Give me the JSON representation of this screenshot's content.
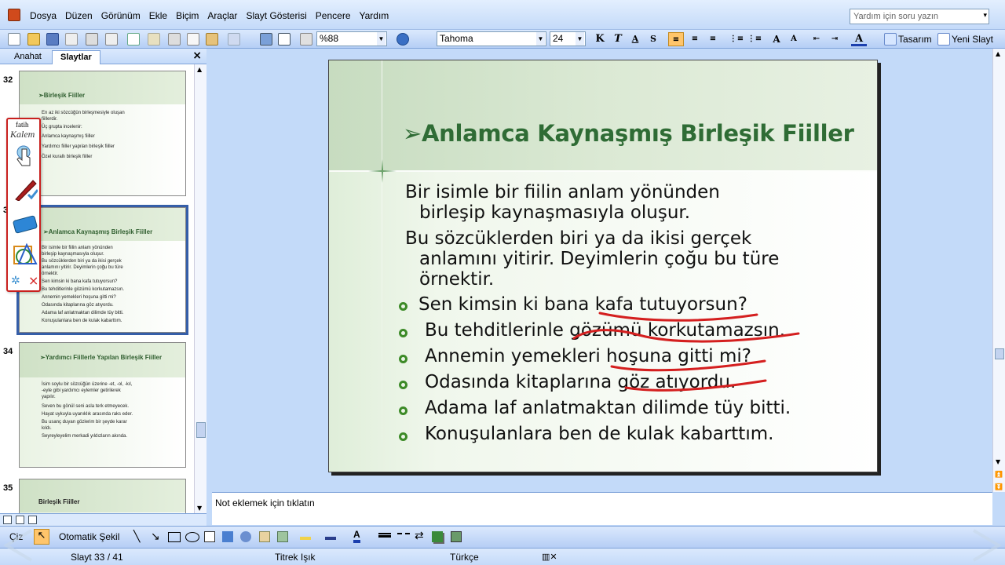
{
  "menu": {
    "items": [
      "Dosya",
      "Düzen",
      "Görünüm",
      "Ekle",
      "Biçim",
      "Araçlar",
      "Slayt Gösterisi",
      "Pencere",
      "Yardım"
    ],
    "help_placeholder": "Yardım için soru yazın"
  },
  "toolbar": {
    "zoom": "%88",
    "font_name": "Tahoma",
    "font_size": "24",
    "bold": "K",
    "italic": "T",
    "underline": "A",
    "shadow": "S",
    "design_label": "Tasarım",
    "new_slide_label": "Yeni Slayt"
  },
  "left_pane": {
    "tabs": [
      "Anahat",
      "Slaytlar"
    ],
    "close": "×",
    "slides": [
      {
        "number": "32",
        "title": "➢Birleşik Fiiller",
        "lines": [
          "En az iki sözcüğün birleşmesiyle oluşan",
          "fiillerdir.",
          "Üç grupta incelenir:",
          "Anlamca kaynaşmış fiiller",
          "Yardımcı fiiller yapılan birleşik fiiller",
          "Özel kurallı birleşik fiiller"
        ]
      },
      {
        "number": "33",
        "title": "➢Anlamca Kaynaşmış Birleşik Fiiller",
        "lines": [
          "Bir isimle bir fiilin anlam yönünden",
          "birleşip kaynaşmasıyla oluşur.",
          "Bu sözcüklerden biri ya da ikisi gerçek",
          "anlamını yitirir. Deyimlerin çoğu bu türe",
          "örnektir.",
          "Sen kimsin ki bana kafa tutuyorsun?",
          "Bu tehditlerinle gözümü korkutamazsın.",
          "Annemin yemekleri hoşuna gitti mi?",
          "Odasında kitaplarına göz atıyordu.",
          "Adama laf anlatmaktan dilimde tüy bitti.",
          "Konuşulanlara ben de kulak kabarttım."
        ]
      },
      {
        "number": "34",
        "title": "➢Yardımcı Fiillerle Yapılan Birleşik Fiiller",
        "lines": [
          "İsim soylu bir sözcüğün üzerine -et, -ol, -kıl,",
          "-eyle gibi yardımcı eylemler getirilerek",
          "yapılır.",
          "Seven bu gönül seni asla terk etmeyecek.",
          "Hayat uykuyla uyanıklık arasında raks eder.",
          "Bu usanç duyan gözlerim bir şeyde karar",
          "kıldı.",
          "Seyreyleyelim merkadi yıldızların akında."
        ]
      },
      {
        "number": "35",
        "title": "Birleşik Fiiller",
        "lines": []
      }
    ]
  },
  "kalem": {
    "brand_top": "fatih",
    "brand_bottom": "Kalem",
    "close": "×"
  },
  "slide": {
    "title": "Anlamca Kaynaşmış Birleşik Fiiller",
    "title_arrow": "➢",
    "paragraphs": [
      [
        "Bir isimle bir fiilin anlam yönünden",
        "birleşip  kaynaşmasıyla oluşur."
      ],
      [
        "Bu sözcüklerden biri  ya da ikisi gerçek",
        "anlamını yitirir. Deyimlerin çoğu bu türe",
        "örnektir."
      ]
    ],
    "bullets": [
      "Sen kimsin ki bana kafa tutuyorsun?",
      "Bu tehditlerinle gözümü korkutamazsın.",
      "Annemin yemekleri hoşuna gitti mi?",
      "Odasında kitaplarına göz atıyordu.",
      "Adama laf anlatmaktan dilimde tüy bitti.",
      "Konuşulanlara ben de kulak kabarttım."
    ],
    "title_color": "#2f6c35",
    "bullet_color": "#3c8a27",
    "ink_color": "#d41f1f"
  },
  "notes": {
    "placeholder": "Not eklemek için tıklatın"
  },
  "drawbar": {
    "draw_label": "Çiz",
    "autoshapes_label": "Otomatik Şekil"
  },
  "status": {
    "slide": "Slayt 33 / 41",
    "design": "Titrek Işık",
    "language": "Türkçe"
  }
}
